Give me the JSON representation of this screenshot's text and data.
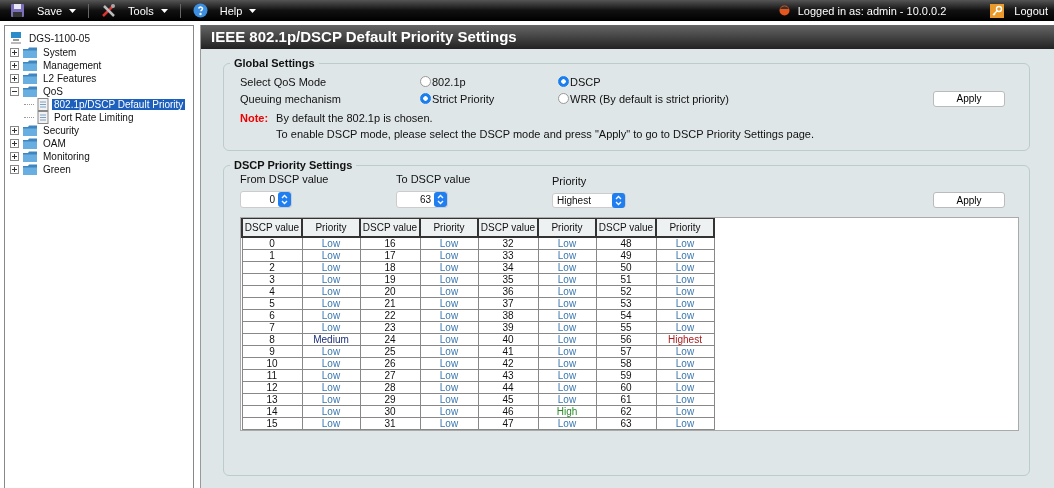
{
  "toolbar": {
    "menus": [
      {
        "label": "Save",
        "kind": "save"
      },
      {
        "label": "Tools",
        "kind": "tools"
      },
      {
        "label": "Help",
        "kind": "help"
      }
    ],
    "login": "Logged in as: admin - 10.0.0.2",
    "logout": "Logout"
  },
  "sidebar": {
    "tree": {
      "label": "DGS-1100-05",
      "kind": "device",
      "children": [
        {
          "label": "System",
          "kind": "folder",
          "expanded": false,
          "selected": false
        },
        {
          "label": "Management",
          "kind": "folder",
          "expanded": false,
          "selected": false
        },
        {
          "label": "L2 Features",
          "kind": "folder",
          "expanded": false,
          "selected": false
        },
        {
          "label": "QoS",
          "kind": "folder",
          "expanded": true,
          "selected": false,
          "children": [
            {
              "label": "802.1p/DSCP Default Priority",
              "kind": "page",
              "selected": true
            },
            {
              "label": "Port Rate Limiting",
              "kind": "page",
              "selected": false
            }
          ]
        },
        {
          "label": "Security",
          "kind": "folder",
          "expanded": false,
          "selected": false
        },
        {
          "label": "OAM",
          "kind": "folder",
          "expanded": false,
          "selected": false
        },
        {
          "label": "Monitoring",
          "kind": "folder",
          "expanded": false,
          "selected": false
        },
        {
          "label": "Green",
          "kind": "folder",
          "expanded": false,
          "selected": false
        }
      ]
    }
  },
  "page_title": "IEEE 802.1p/DSCP Default Priority Settings",
  "global_settings": {
    "title": "Global Settings",
    "rows": [
      {
        "label": "Select QoS Mode",
        "options": [
          {
            "label": "802.1p",
            "selected": false
          },
          {
            "label": "DSCP",
            "selected": true
          }
        ]
      },
      {
        "label": "Queuing mechanism",
        "options": [
          {
            "label": "Strict Priority",
            "selected": true
          },
          {
            "label": "WRR (By default is strict priority)",
            "selected": false
          }
        ]
      }
    ],
    "note_label": "Note:",
    "note_lines": [
      "By default the 802.1p is chosen.",
      "To enable DSCP mode, please select the DSCP mode and press \"Apply\" to go to DSCP Priority Settings page."
    ],
    "apply": "Apply"
  },
  "dscp_settings": {
    "title": "DSCP Priority Settings",
    "fields": [
      {
        "label": "From DSCP value",
        "value": "0",
        "kind": "number"
      },
      {
        "label": "To DSCP value",
        "value": "63",
        "kind": "number"
      },
      {
        "label": "Priority",
        "value": "Highest",
        "kind": "text"
      }
    ],
    "apply": "Apply",
    "table": {
      "columns": [
        "DSCP value",
        "Priority",
        "DSCP value",
        "Priority",
        "DSCP value",
        "Priority",
        "DSCP value",
        "Priority"
      ],
      "rows": [
        [
          {
            "text": "0",
            "kind": "value"
          },
          {
            "text": "Low",
            "kind": "low"
          },
          {
            "text": "16",
            "kind": "value"
          },
          {
            "text": "Low",
            "kind": "low"
          },
          {
            "text": "32",
            "kind": "value"
          },
          {
            "text": "Low",
            "kind": "low"
          },
          {
            "text": "48",
            "kind": "value"
          },
          {
            "text": "Low",
            "kind": "low"
          }
        ],
        [
          {
            "text": "1",
            "kind": "value"
          },
          {
            "text": "Low",
            "kind": "low"
          },
          {
            "text": "17",
            "kind": "value"
          },
          {
            "text": "Low",
            "kind": "low"
          },
          {
            "text": "33",
            "kind": "value"
          },
          {
            "text": "Low",
            "kind": "low"
          },
          {
            "text": "49",
            "kind": "value"
          },
          {
            "text": "Low",
            "kind": "low"
          }
        ],
        [
          {
            "text": "2",
            "kind": "value"
          },
          {
            "text": "Low",
            "kind": "low"
          },
          {
            "text": "18",
            "kind": "value"
          },
          {
            "text": "Low",
            "kind": "low"
          },
          {
            "text": "34",
            "kind": "value"
          },
          {
            "text": "Low",
            "kind": "low"
          },
          {
            "text": "50",
            "kind": "value"
          },
          {
            "text": "Low",
            "kind": "low"
          }
        ],
        [
          {
            "text": "3",
            "kind": "value"
          },
          {
            "text": "Low",
            "kind": "low"
          },
          {
            "text": "19",
            "kind": "value"
          },
          {
            "text": "Low",
            "kind": "low"
          },
          {
            "text": "35",
            "kind": "value"
          },
          {
            "text": "Low",
            "kind": "low"
          },
          {
            "text": "51",
            "kind": "value"
          },
          {
            "text": "Low",
            "kind": "low"
          }
        ],
        [
          {
            "text": "4",
            "kind": "value"
          },
          {
            "text": "Low",
            "kind": "low"
          },
          {
            "text": "20",
            "kind": "value"
          },
          {
            "text": "Low",
            "kind": "low"
          },
          {
            "text": "36",
            "kind": "value"
          },
          {
            "text": "Low",
            "kind": "low"
          },
          {
            "text": "52",
            "kind": "value"
          },
          {
            "text": "Low",
            "kind": "low"
          }
        ],
        [
          {
            "text": "5",
            "kind": "value"
          },
          {
            "text": "Low",
            "kind": "low"
          },
          {
            "text": "21",
            "kind": "value"
          },
          {
            "text": "Low",
            "kind": "low"
          },
          {
            "text": "37",
            "kind": "value"
          },
          {
            "text": "Low",
            "kind": "low"
          },
          {
            "text": "53",
            "kind": "value"
          },
          {
            "text": "Low",
            "kind": "low"
          }
        ],
        [
          {
            "text": "6",
            "kind": "value"
          },
          {
            "text": "Low",
            "kind": "low"
          },
          {
            "text": "22",
            "kind": "value"
          },
          {
            "text": "Low",
            "kind": "low"
          },
          {
            "text": "38",
            "kind": "value"
          },
          {
            "text": "Low",
            "kind": "low"
          },
          {
            "text": "54",
            "kind": "value"
          },
          {
            "text": "Low",
            "kind": "low"
          }
        ],
        [
          {
            "text": "7",
            "kind": "value"
          },
          {
            "text": "Low",
            "kind": "low"
          },
          {
            "text": "23",
            "kind": "value"
          },
          {
            "text": "Low",
            "kind": "low"
          },
          {
            "text": "39",
            "kind": "value"
          },
          {
            "text": "Low",
            "kind": "low"
          },
          {
            "text": "55",
            "kind": "value"
          },
          {
            "text": "Low",
            "kind": "low"
          }
        ],
        [
          {
            "text": "8",
            "kind": "value"
          },
          {
            "text": "Medium",
            "kind": "medium"
          },
          {
            "text": "24",
            "kind": "value"
          },
          {
            "text": "Low",
            "kind": "low"
          },
          {
            "text": "40",
            "kind": "value"
          },
          {
            "text": "Low",
            "kind": "low"
          },
          {
            "text": "56",
            "kind": "value"
          },
          {
            "text": "Highest",
            "kind": "highest"
          }
        ],
        [
          {
            "text": "9",
            "kind": "value"
          },
          {
            "text": "Low",
            "kind": "low"
          },
          {
            "text": "25",
            "kind": "value"
          },
          {
            "text": "Low",
            "kind": "low"
          },
          {
            "text": "41",
            "kind": "value"
          },
          {
            "text": "Low",
            "kind": "low"
          },
          {
            "text": "57",
            "kind": "value"
          },
          {
            "text": "Low",
            "kind": "low"
          }
        ],
        [
          {
            "text": "10",
            "kind": "value"
          },
          {
            "text": "Low",
            "kind": "low"
          },
          {
            "text": "26",
            "kind": "value"
          },
          {
            "text": "Low",
            "kind": "low"
          },
          {
            "text": "42",
            "kind": "value"
          },
          {
            "text": "Low",
            "kind": "low"
          },
          {
            "text": "58",
            "kind": "value"
          },
          {
            "text": "Low",
            "kind": "low"
          }
        ],
        [
          {
            "text": "11",
            "kind": "value"
          },
          {
            "text": "Low",
            "kind": "low"
          },
          {
            "text": "27",
            "kind": "value"
          },
          {
            "text": "Low",
            "kind": "low"
          },
          {
            "text": "43",
            "kind": "value"
          },
          {
            "text": "Low",
            "kind": "low"
          },
          {
            "text": "59",
            "kind": "value"
          },
          {
            "text": "Low",
            "kind": "low"
          }
        ],
        [
          {
            "text": "12",
            "kind": "value"
          },
          {
            "text": "Low",
            "kind": "low"
          },
          {
            "text": "28",
            "kind": "value"
          },
          {
            "text": "Low",
            "kind": "low"
          },
          {
            "text": "44",
            "kind": "value"
          },
          {
            "text": "Low",
            "kind": "low"
          },
          {
            "text": "60",
            "kind": "value"
          },
          {
            "text": "Low",
            "kind": "low"
          }
        ],
        [
          {
            "text": "13",
            "kind": "value"
          },
          {
            "text": "Low",
            "kind": "low"
          },
          {
            "text": "29",
            "kind": "value"
          },
          {
            "text": "Low",
            "kind": "low"
          },
          {
            "text": "45",
            "kind": "value"
          },
          {
            "text": "Low",
            "kind": "low"
          },
          {
            "text": "61",
            "kind": "value"
          },
          {
            "text": "Low",
            "kind": "low"
          }
        ],
        [
          {
            "text": "14",
            "kind": "value"
          },
          {
            "text": "Low",
            "kind": "low"
          },
          {
            "text": "30",
            "kind": "value"
          },
          {
            "text": "Low",
            "kind": "low"
          },
          {
            "text": "46",
            "kind": "value"
          },
          {
            "text": "High",
            "kind": "high"
          },
          {
            "text": "62",
            "kind": "value"
          },
          {
            "text": "Low",
            "kind": "low"
          }
        ],
        [
          {
            "text": "15",
            "kind": "value"
          },
          {
            "text": "Low",
            "kind": "low"
          },
          {
            "text": "31",
            "kind": "value"
          },
          {
            "text": "Low",
            "kind": "low"
          },
          {
            "text": "47",
            "kind": "value"
          },
          {
            "text": "Low",
            "kind": "low"
          },
          {
            "text": "63",
            "kind": "value"
          },
          {
            "text": "Low",
            "kind": "low"
          }
        ]
      ]
    }
  }
}
